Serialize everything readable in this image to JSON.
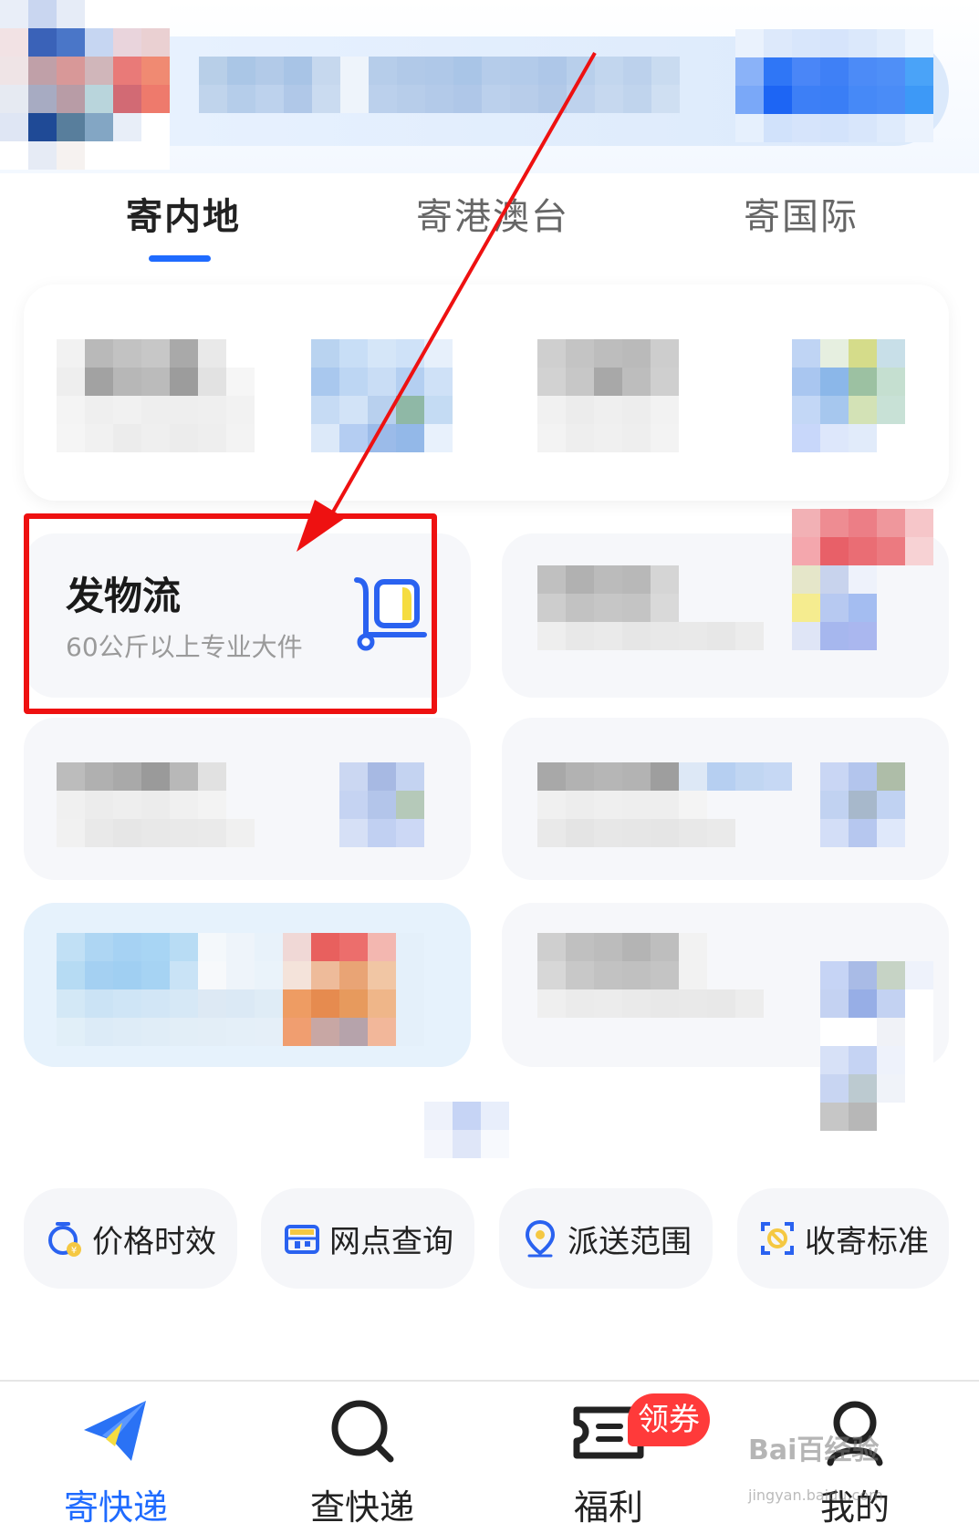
{
  "tabs": [
    {
      "label": "寄内地",
      "active": true
    },
    {
      "label": "寄港澳台",
      "active": false
    },
    {
      "label": "寄国际",
      "active": false
    }
  ],
  "logistics_card": {
    "title": "发物流",
    "subtitle": "60公斤以上专业大件"
  },
  "quick_actions": [
    {
      "label": "价格时效",
      "icon": "price-timer-icon"
    },
    {
      "label": "网点查询",
      "icon": "store-icon"
    },
    {
      "label": "派送范围",
      "icon": "location-pin-icon"
    },
    {
      "label": "收寄标准",
      "icon": "prohibited-scan-icon"
    }
  ],
  "bottom_nav": [
    {
      "label": "寄快递",
      "icon": "paper-plane-icon",
      "active": true
    },
    {
      "label": "查快递",
      "icon": "search-icon",
      "active": false
    },
    {
      "label": "福利",
      "icon": "ticket-icon",
      "active": false,
      "badge": "领券"
    },
    {
      "label": "我的",
      "icon": "user-icon",
      "active": false
    }
  ],
  "watermark": {
    "text": "Bai百经验",
    "subtext": "jingyan.baidu.com"
  },
  "colors": {
    "accent": "#1f6bff",
    "annotation_red": "#ee1111",
    "badge_red": "#ff3a3a"
  }
}
